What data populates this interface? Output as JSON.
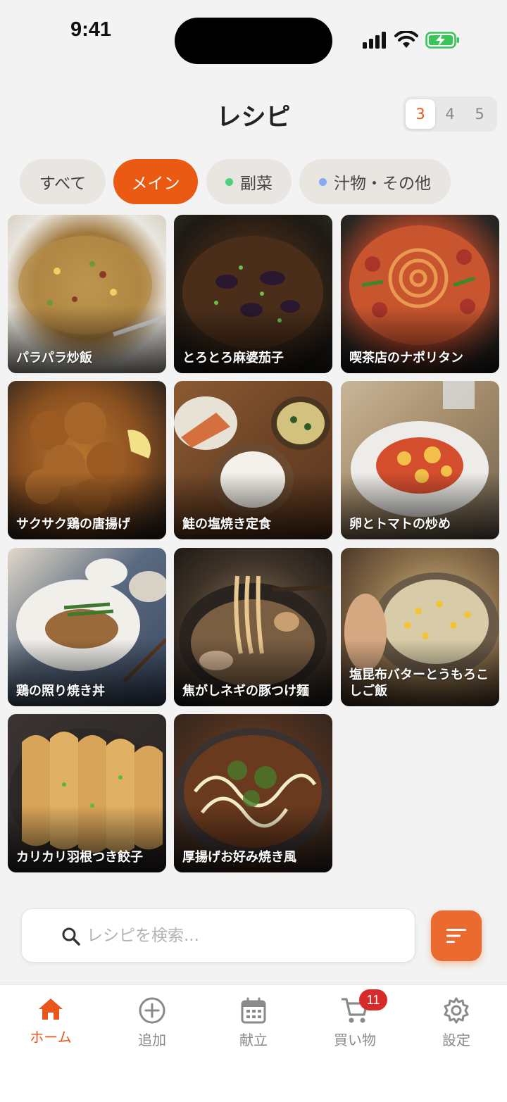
{
  "status_bar": {
    "time": "9:41"
  },
  "header": {
    "title": "レシピ",
    "column_options": [
      "3",
      "4",
      "5"
    ],
    "selected_columns": "3"
  },
  "categories": [
    {
      "label": "すべて",
      "active": false
    },
    {
      "label": "メイン",
      "active": true
    },
    {
      "label": "副菜",
      "dot_color": "#4cd17a"
    },
    {
      "label": "汁物・その他",
      "dot_color": "#86a9f5"
    }
  ],
  "recipes": [
    {
      "name": "パラパラ炒飯"
    },
    {
      "name": "とろとろ麻婆茄子"
    },
    {
      "name": "喫茶店のナポリタン"
    },
    {
      "name": "サクサク鶏の唐揚げ"
    },
    {
      "name": "鮭の塩焼き定食"
    },
    {
      "name": "卵とトマトの炒め"
    },
    {
      "name": "鶏の照り焼き丼"
    },
    {
      "name": "焦がしネギの豚つけ麺"
    },
    {
      "name": "塩昆布バターとうもろこしご飯"
    },
    {
      "name": "カリカリ羽根つき餃子"
    },
    {
      "name": "厚揚げお好み焼き風"
    }
  ],
  "search": {
    "placeholder": "レシピを検索...",
    "value": ""
  },
  "tabbar": {
    "items": [
      {
        "label": "ホーム",
        "icon": "home-icon",
        "active": true
      },
      {
        "label": "追加",
        "icon": "plus-circle-icon"
      },
      {
        "label": "献立",
        "icon": "calendar-icon"
      },
      {
        "label": "買い物",
        "icon": "cart-icon",
        "badge": "11"
      },
      {
        "label": "設定",
        "icon": "gear-icon"
      }
    ]
  },
  "colors": {
    "accent": "#ea5a12",
    "background": "#f3f3f3"
  }
}
